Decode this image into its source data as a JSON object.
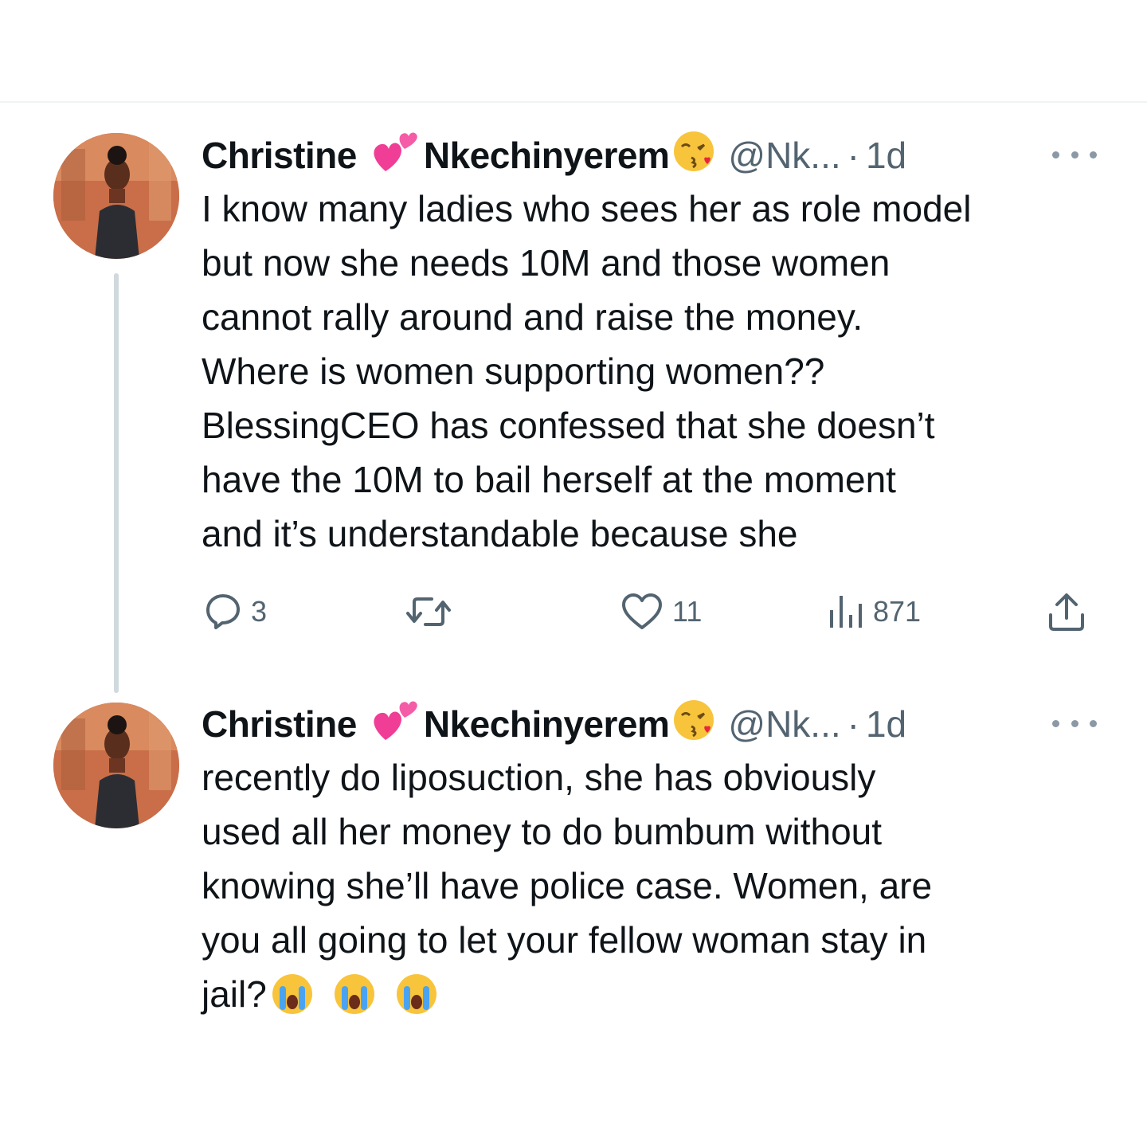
{
  "tweets": [
    {
      "name_first": "Christine",
      "name_emoji": "💞",
      "name_last": "Nkechinyerem",
      "name_emoji_end": "😘",
      "handle": "@Nk...",
      "separator": "·",
      "time": "1d",
      "lines": [
        "I know many ladies who sees her as role model",
        "but now she needs 10M and those women",
        "cannot rally around and raise the money.",
        "Where is women supporting women??",
        "BlessingCEO has confessed that she doesn’t",
        "have the 10M to bail herself at the moment",
        "and it’s understandable because she"
      ],
      "actions": {
        "replies": "3",
        "retweets": "",
        "likes": "11",
        "views": "871"
      }
    },
    {
      "name_first": "Christine",
      "name_emoji": "💞",
      "name_last": "Nkechinyerem",
      "name_emoji_end": "😘",
      "handle": "@Nk...",
      "separator": "·",
      "time": "1d",
      "lines": [
        "recently do liposuction, she has obviously",
        "used all her money to do bumbum without",
        "knowing she’ll have police case. Women, are",
        "you all going to let your fellow woman stay in",
        "jail?"
      ],
      "trailing_emoji": "😭😭😭"
    }
  ],
  "icons": {
    "reply": "reply-icon",
    "retweet": "retweet-icon",
    "like": "heart-icon",
    "views": "views-chart-icon",
    "share": "share-icon",
    "more": "more-icon"
  },
  "colors": {
    "text": "#0f1419",
    "secondary": "#536471",
    "thread_line": "#cfd9de",
    "divider": "#eff3f4"
  }
}
